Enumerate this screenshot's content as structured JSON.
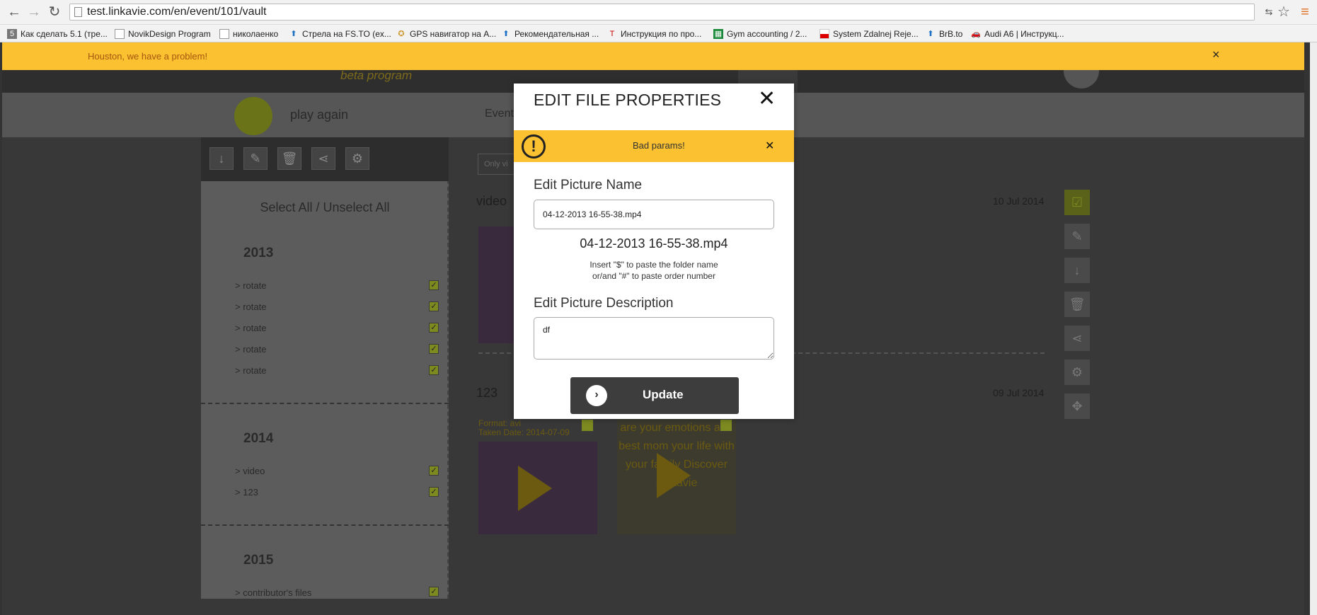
{
  "browser": {
    "url": "test.linkavie.com/en/event/101/vault",
    "bookmarks": [
      "Как сделать 5.1 (тре...",
      "NovikDesign Program",
      "николаенко",
      "Стрела на FS.TO (ex...",
      "GPS навигатор на A...",
      "Рекомендательная ...",
      "Инструкция по про...",
      "Gym accounting / 2...",
      "System Zdalnej Reje...",
      "BrB.to",
      "Audi A6 | Инструкц..."
    ]
  },
  "alert": {
    "message": "Houston, we have a problem!",
    "close": "×"
  },
  "header": {
    "logo_sub": "beta program",
    "title": "play again",
    "nav_item": "Event"
  },
  "sidebar": {
    "select_all": "Select All / Unselect All",
    "groups": [
      {
        "year": "2013",
        "items": [
          "rotate",
          "rotate",
          "rotate",
          "rotate",
          "rotate"
        ]
      },
      {
        "year": "2014",
        "items": [
          "video",
          "123"
        ]
      },
      {
        "year": "2015",
        "items": [
          "contributor's files"
        ]
      }
    ]
  },
  "content": {
    "filter_btn": "Only vi",
    "sections": [
      {
        "title": "video",
        "date": "10 Jul 2014"
      },
      {
        "title": "123",
        "date": "09 Jul 2014"
      }
    ],
    "thumb_meta": {
      "format": "Format: avi",
      "taken": "Taken Date: 2014-07-09"
    },
    "thumb2_text": "are your emotions and best mom your life with your family Discover Linkavie"
  },
  "modal": {
    "title": "EDIT FILE PROPERTIES",
    "close": "✕",
    "error": "Bad params!",
    "error_close": "✕",
    "name_label": "Edit Picture Name",
    "name_value": "04-12-2013 16-55-38.mp4",
    "name_preview": "04-12-2013 16-55-38.mp4",
    "hint_line1": "Insert \"$\" to paste the folder name",
    "hint_line2": "or/and \"#\" to paste order number",
    "desc_label": "Edit Picture Description",
    "desc_value": "df",
    "update": "Update"
  }
}
